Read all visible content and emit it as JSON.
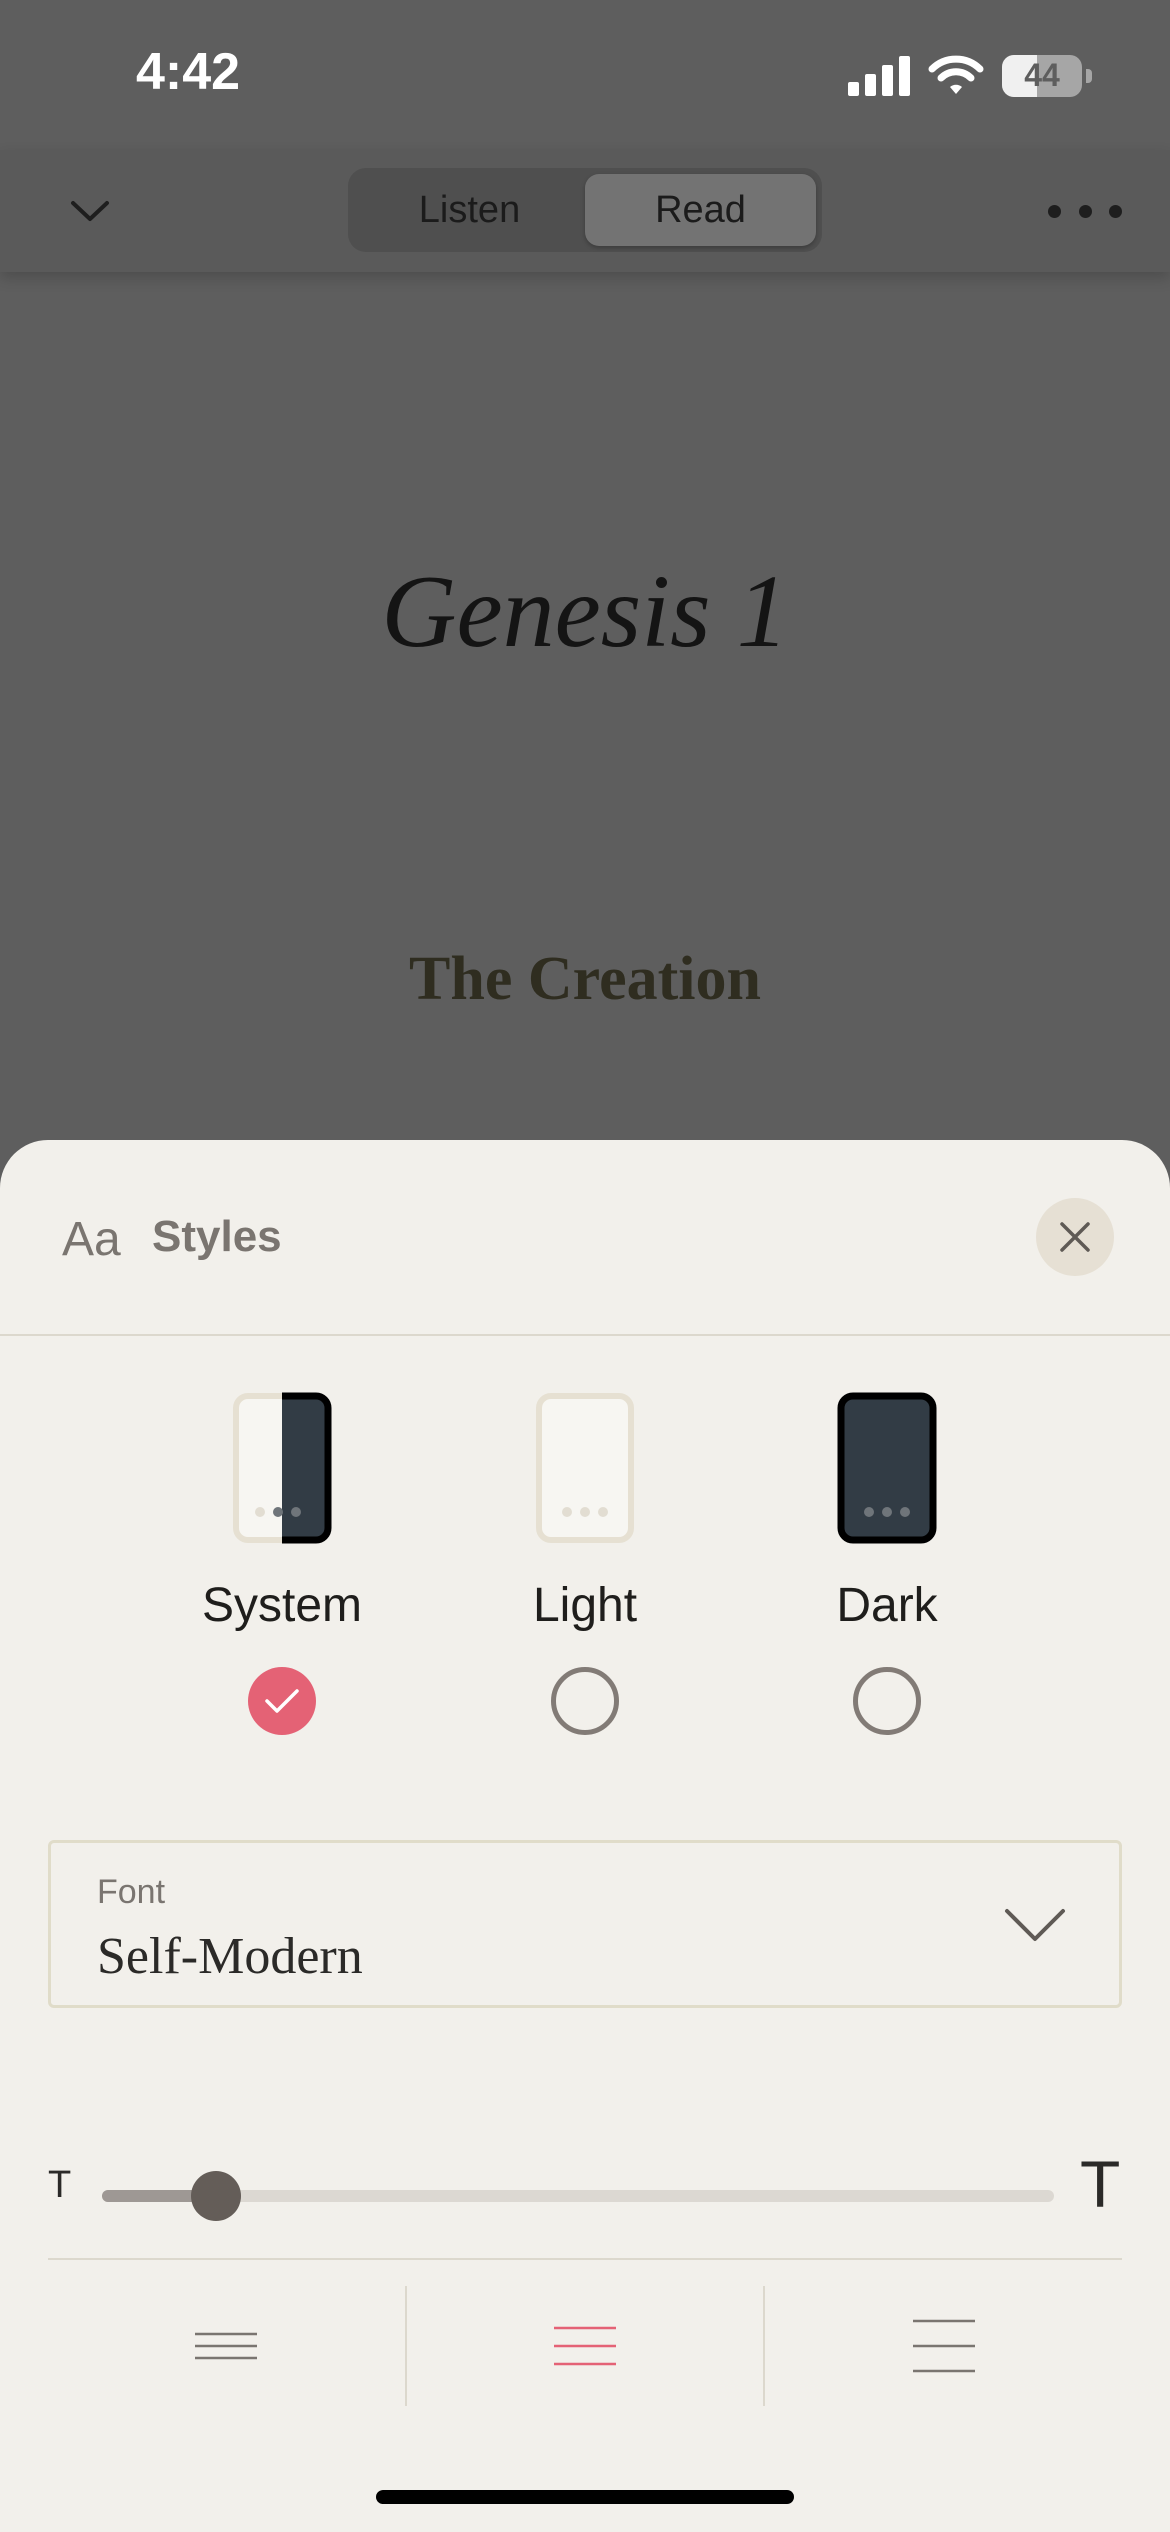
{
  "status_bar": {
    "time": "4:42",
    "battery_level": "44",
    "battery_fraction": 0.44
  },
  "nav": {
    "tabs": [
      {
        "label": "Listen",
        "active": false
      },
      {
        "label": "Read",
        "active": true
      }
    ]
  },
  "reading": {
    "chapter_title": "Genesis 1",
    "section_heading": "The Creation"
  },
  "styles_sheet": {
    "icon_text": "Aa",
    "title": "Styles",
    "themes": [
      {
        "name": "System",
        "selected": true
      },
      {
        "name": "Light",
        "selected": false
      },
      {
        "name": "Dark",
        "selected": false
      }
    ],
    "font": {
      "label": "Font",
      "value": "Self-Modern"
    },
    "text_size": {
      "small_label": "T",
      "large_label": "T",
      "level_fraction": 0.12
    },
    "line_spacing": {
      "options": [
        "compact",
        "normal",
        "loose"
      ],
      "selected": "normal"
    },
    "colors": {
      "accent": "#e46275",
      "sheet_background": "#f2f0eb",
      "dark_theme": "#323c45"
    }
  }
}
